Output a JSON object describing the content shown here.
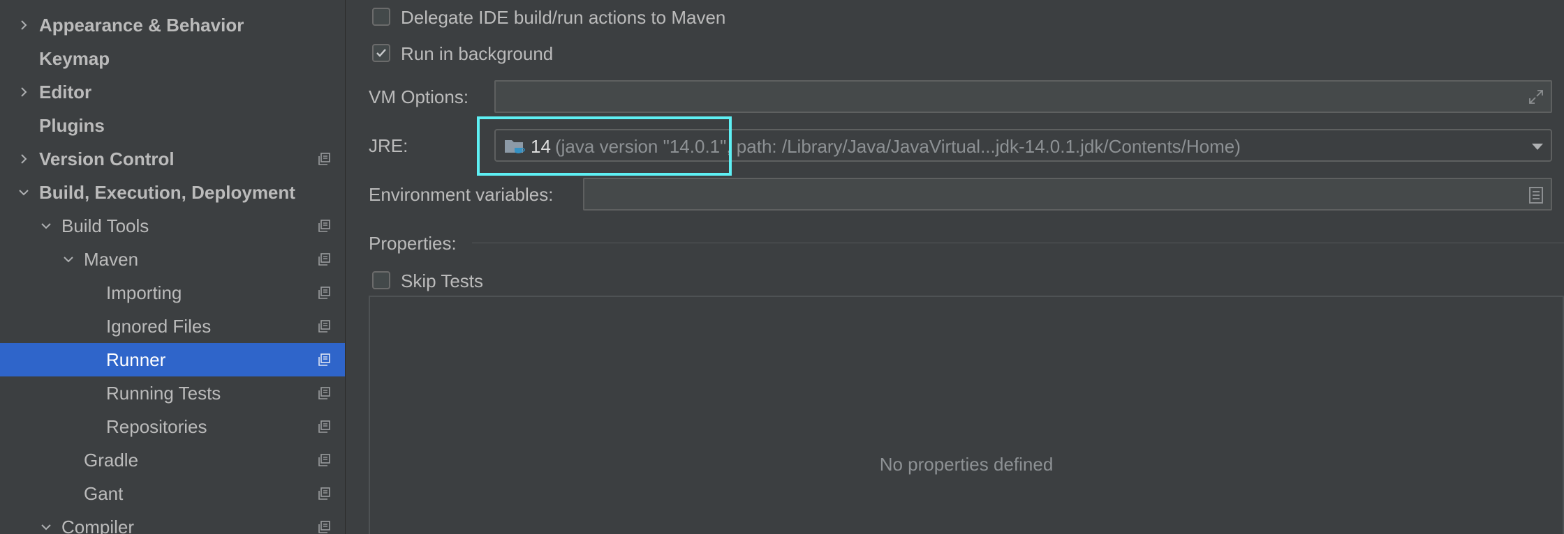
{
  "sidebar": {
    "items": [
      {
        "label": "Appearance & Behavior",
        "chevron": "right",
        "bold": true
      },
      {
        "label": "Keymap",
        "bold": true
      },
      {
        "label": "Editor",
        "chevron": "right",
        "bold": true
      },
      {
        "label": "Plugins",
        "bold": true
      },
      {
        "label": "Version Control",
        "chevron": "right",
        "bold": true,
        "project_icon": "project-settings-icon"
      },
      {
        "label": "Build, Execution, Deployment",
        "chevron": "down",
        "bold": true
      },
      {
        "label": "Build Tools",
        "chevron": "down",
        "project_icon": "project-settings-icon"
      },
      {
        "label": "Maven",
        "chevron": "down",
        "project_icon": "project-settings-icon"
      },
      {
        "label": "Importing",
        "project_icon": "project-settings-icon"
      },
      {
        "label": "Ignored Files",
        "project_icon": "project-settings-icon"
      },
      {
        "label": "Runner",
        "selected": true,
        "project_icon": "project-settings-icon"
      },
      {
        "label": "Running Tests",
        "project_icon": "project-settings-icon"
      },
      {
        "label": "Repositories",
        "project_icon": "project-settings-icon"
      },
      {
        "label": "Gradle",
        "project_icon": "project-settings-icon"
      },
      {
        "label": "Gant",
        "project_icon": "project-settings-icon"
      },
      {
        "label": "Compiler",
        "chevron": "down",
        "project_icon": "project-settings-icon"
      }
    ]
  },
  "runner": {
    "delegate_label": "Delegate IDE build/run actions to Maven",
    "delegate_checked": false,
    "background_label": "Run in background",
    "background_checked": true,
    "vm_options_label": "VM Options:",
    "vm_options_value": "",
    "jre_label": "JRE:",
    "jre_version": "14",
    "jre_detail": "(java version \"14.0.1\", path: /Library/Java/JavaVirtual...jdk-14.0.1.jdk/Contents/Home)",
    "env_label": "Environment variables:",
    "env_value": "",
    "properties_label": "Properties:",
    "skip_tests_label": "Skip Tests",
    "skip_tests_checked": false,
    "no_properties": "No properties defined"
  },
  "colors": {
    "background": "#3c3f41",
    "selection": "#2f65ca",
    "highlight": "#5ef0f4"
  }
}
